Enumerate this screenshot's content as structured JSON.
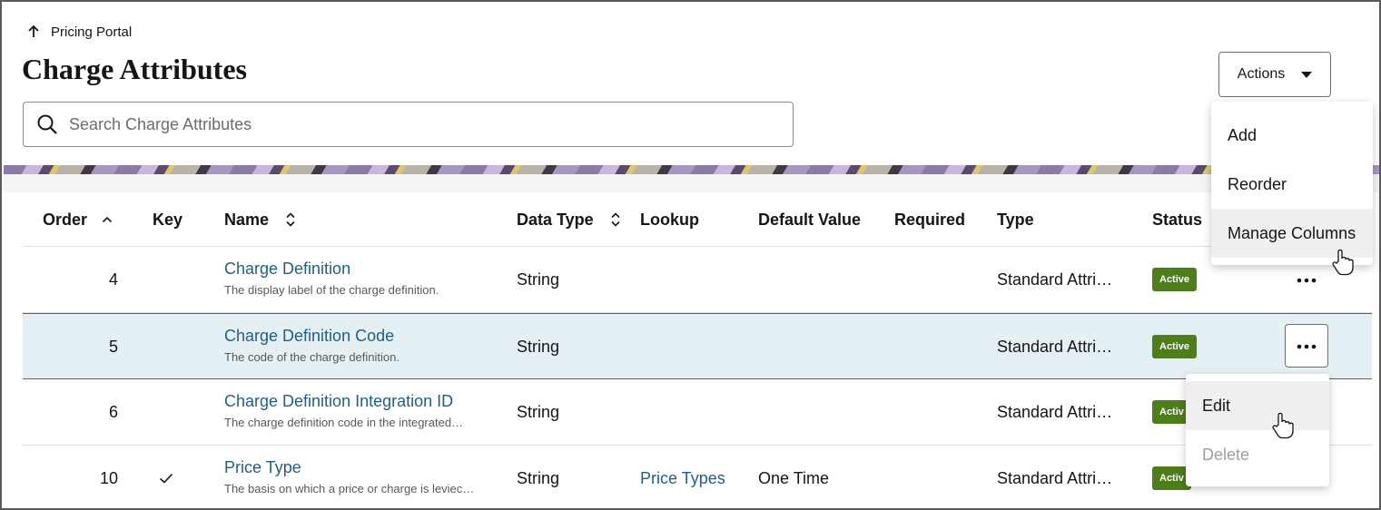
{
  "breadcrumb": {
    "label": "Pricing Portal",
    "icon": "arrow-up-icon"
  },
  "page": {
    "title": "Charge Attributes"
  },
  "search": {
    "placeholder": "Search Charge Attributes",
    "value": "",
    "icon": "search-icon"
  },
  "actions": {
    "label": "Actions",
    "menu": [
      {
        "label": "Add"
      },
      {
        "label": "Reorder"
      },
      {
        "label": "Manage Columns"
      }
    ]
  },
  "columns": {
    "order": "Order",
    "key": "Key",
    "name": "Name",
    "data_type": "Data Type",
    "lookup": "Lookup",
    "default_value": "Default Value",
    "required": "Required",
    "type": "Type",
    "status": "Status"
  },
  "rows": [
    {
      "order": "4",
      "key": "",
      "name": "Charge Definition",
      "description": "The display label of the charge definition.",
      "data_type": "String",
      "lookup": "",
      "default_value": "",
      "required": "",
      "type": "Standard Attri…",
      "status": "Active"
    },
    {
      "order": "5",
      "key": "",
      "name": "Charge Definition Code",
      "description": "The code of the charge definition.",
      "data_type": "String",
      "lookup": "",
      "default_value": "",
      "required": "",
      "type": "Standard Attri…",
      "status": "Active"
    },
    {
      "order": "6",
      "key": "",
      "name": "Charge Definition Integration ID",
      "description": "The charge definition code in the integrated…",
      "data_type": "String",
      "lookup": "",
      "default_value": "",
      "required": "",
      "type": "Standard Attri…",
      "status": "Activ"
    },
    {
      "order": "10",
      "key": "✓",
      "name": "Price Type",
      "description": "The basis on which a price or charge is leviec…",
      "data_type": "String",
      "lookup": "Price Types",
      "default_value": "One Time",
      "required": "",
      "type": "Standard Attri…",
      "status": "Activ"
    }
  ],
  "row_menu": [
    {
      "label": "Edit",
      "enabled": true
    },
    {
      "label": "Delete",
      "enabled": false
    }
  ],
  "colors": {
    "link": "#1f5f84",
    "active_badge": "#4e7d1b",
    "selected_row": "#e5f0f4"
  }
}
